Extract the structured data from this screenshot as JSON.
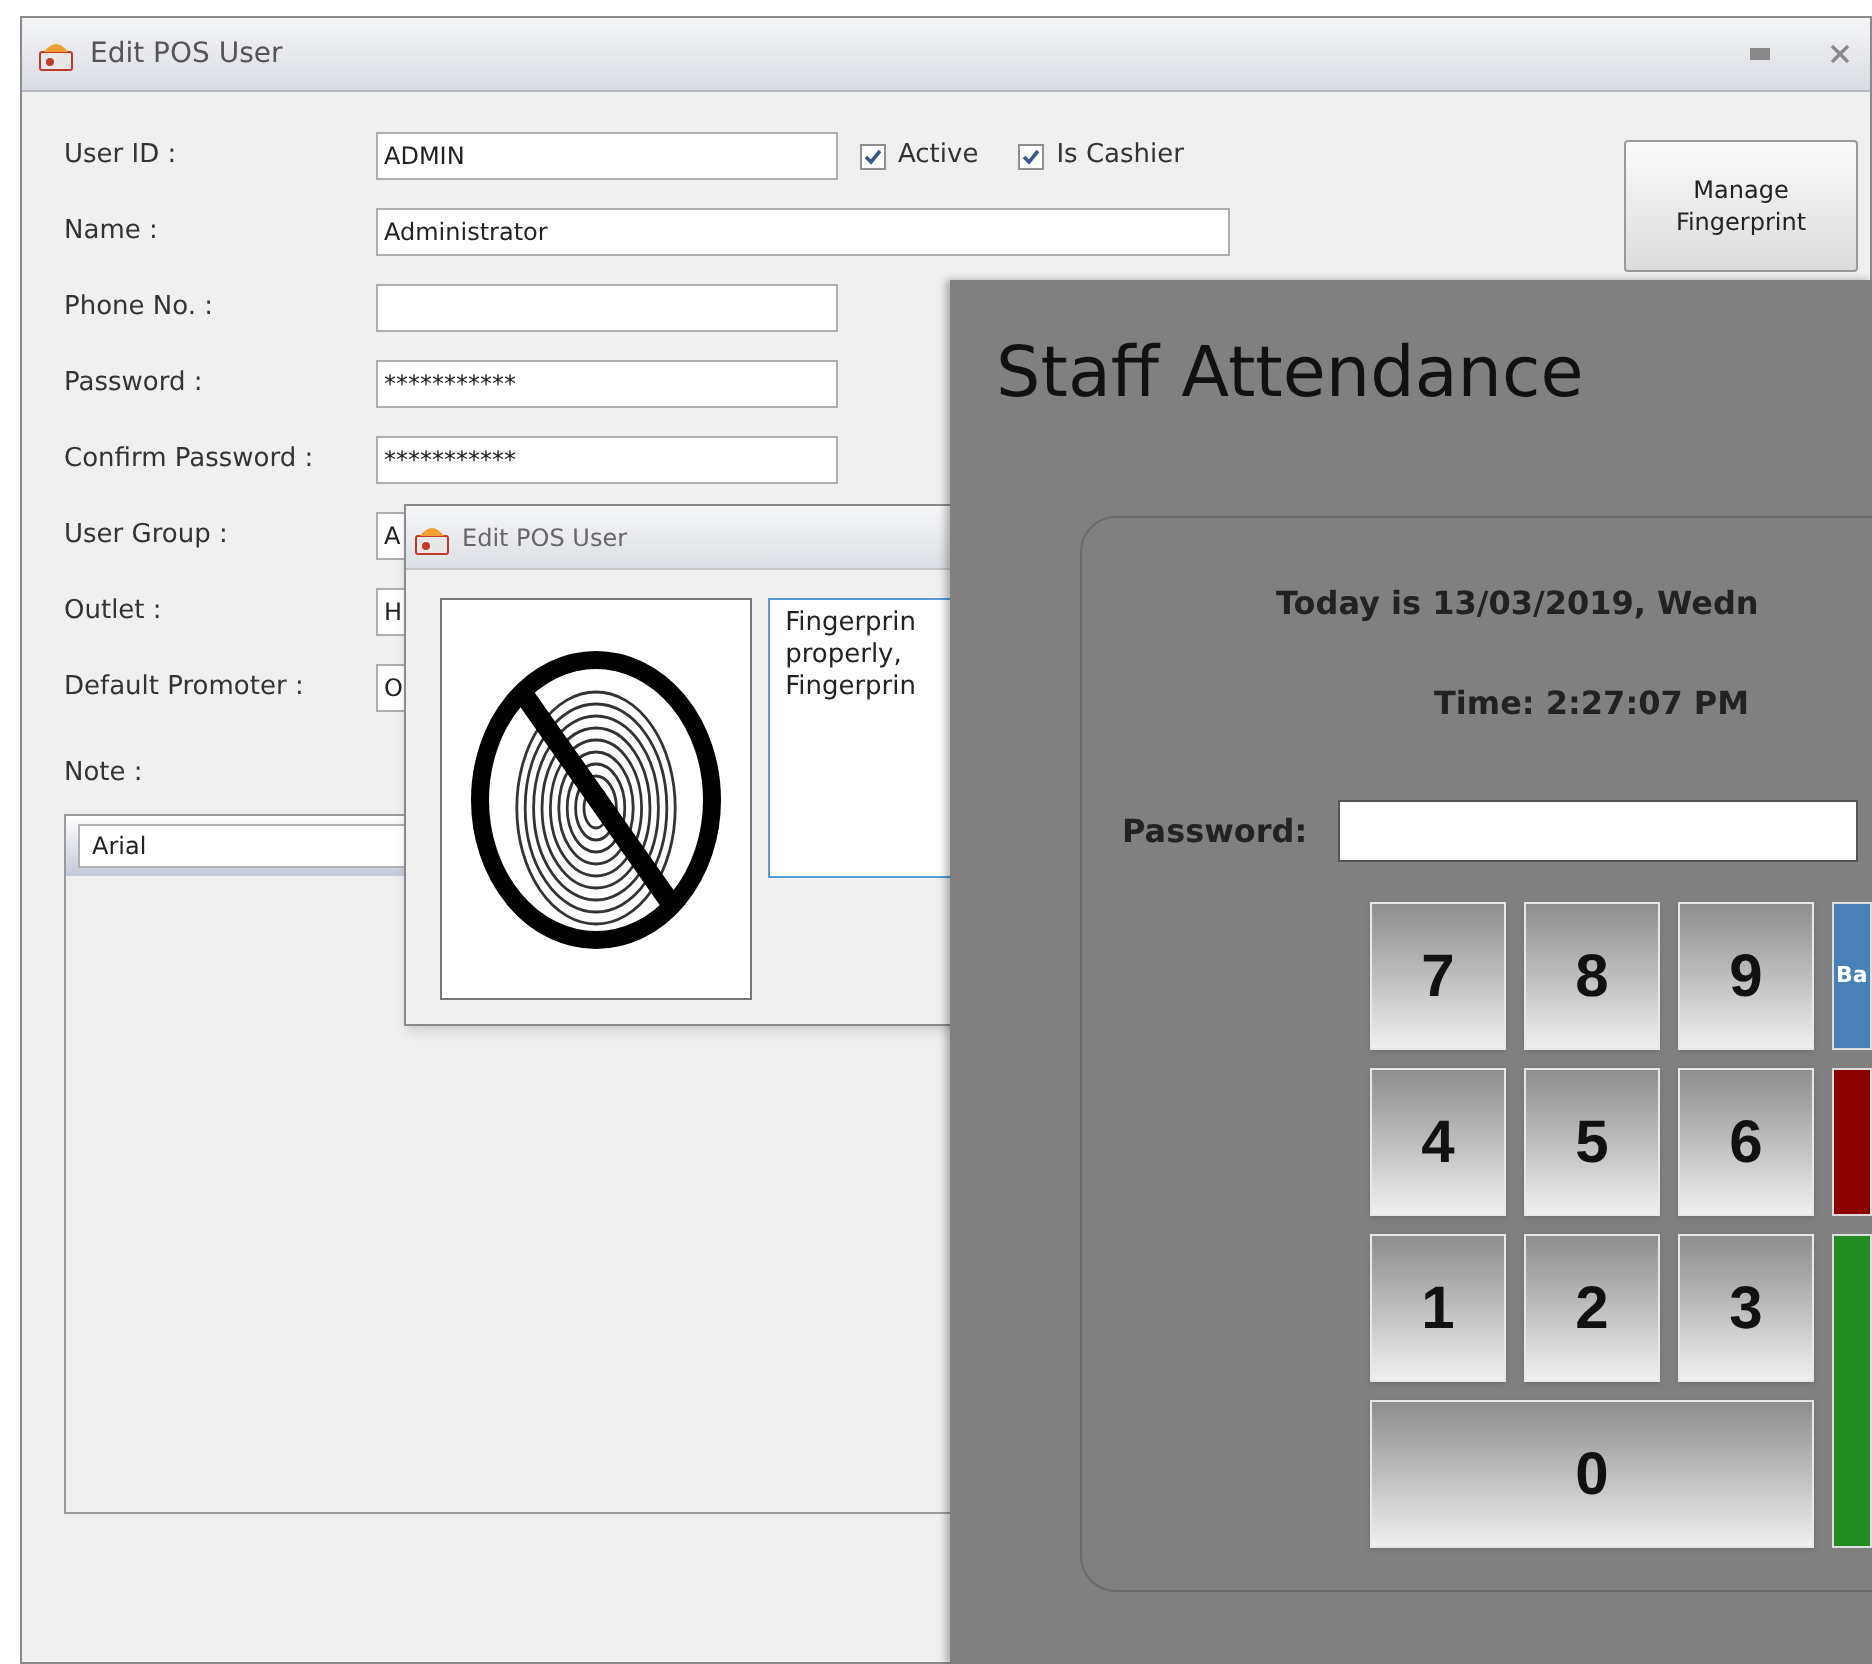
{
  "main_window": {
    "title": "Edit POS User",
    "fields": [
      {
        "label": "User ID :",
        "value": "ADMIN",
        "kind": "short"
      },
      {
        "label": "Name :",
        "value": "Administrator",
        "kind": "wide"
      },
      {
        "label": "Phone No. :",
        "kind": "short"
      },
      {
        "label": "Password :",
        "value": "***********",
        "kind": "short"
      },
      {
        "label": "Confirm Password :",
        "value": "***********",
        "kind": "short"
      },
      {
        "label": "User Group :",
        "value": "A",
        "kind": "short"
      },
      {
        "label": "Outlet :",
        "value": "H",
        "kind": "short"
      },
      {
        "label": "Default Promoter :",
        "value": "O",
        "kind": "short"
      }
    ],
    "checkboxes": [
      {
        "label": "Active",
        "checked": true
      },
      {
        "label": "Is Cashier",
        "checked": true
      }
    ],
    "manage_button": "Manage Fingerprint",
    "note_label": "Note :",
    "font_combo": "Arial"
  },
  "fingerprint_dialog": {
    "title": "Edit POS User",
    "message_lines": [
      "Fingerprin",
      "properly,",
      "Fingerprin"
    ]
  },
  "attendance": {
    "title": "Staff Attendance",
    "date_line": "Today is 13/03/2019, Wedn",
    "time_line": "Time: 2:27:07 PM",
    "password_label": "Password:",
    "digit_rows": [
      [
        "7",
        "8",
        "9"
      ],
      [
        "4",
        "5",
        "6"
      ],
      [
        "1",
        "2",
        "3"
      ],
      [
        "0"
      ]
    ],
    "action_buttons": [
      {
        "label": "Ba",
        "color": "#4a80b8"
      },
      {
        "color": "#8b0000"
      },
      {
        "color": "#228b22"
      }
    ]
  }
}
